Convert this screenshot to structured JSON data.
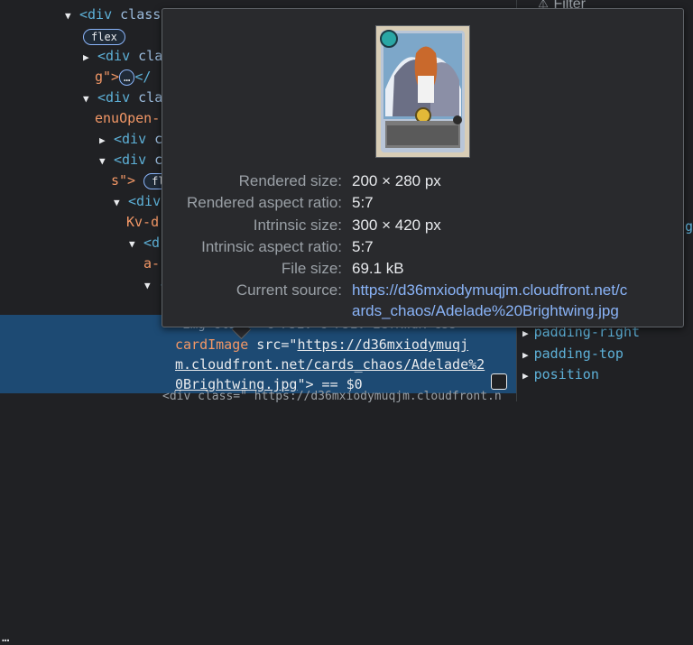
{
  "dom": {
    "line1": {
      "open": "<div",
      "attr": "class"
    },
    "badge_flex": "flex",
    "line3": {
      "open": "<div",
      "attr": "cla"
    },
    "line4": {
      "text1": "g\">",
      "ellipsis": "…",
      "text2": "</"
    },
    "line5": {
      "open": "<div",
      "attr": "cla"
    },
    "line6": {
      "text": "enuOpen-"
    },
    "line7": {
      "open": "<div",
      "attr": "c"
    },
    "line8": {
      "open": "<div",
      "attr": "c"
    },
    "line9": {
      "text": "s\">",
      "badge": "fl"
    },
    "line10": {
      "open": "<div"
    },
    "line11": {
      "text": "Kv-d"
    },
    "line12": {
      "open": "<d"
    },
    "line13": {
      "text": "a-"
    },
    "line14": {
      "text": "-"
    }
  },
  "selected": {
    "dots": "…",
    "img_partial": "<img class=\"c-PJEV c-PJEV-ieTKwdK-css",
    "line2_class": "cardImage",
    "src_attr": " src=\"",
    "url_part1": "https://d36mxiodymuqj",
    "url_part2": "m.cloudfront.net/cards_chaos/Adelade%2",
    "url_part3": "0Brightwing.jpg",
    "tail": "\"> == $0",
    "next_line": "<div class=\"     https://d36mxiodymuqjm.cloudfront.n"
  },
  "styles_panel": {
    "filter_label": "Filter",
    "props": [
      "padding-right",
      "padding-top",
      "position"
    ],
    "right_text": "g"
  },
  "tooltip": {
    "rows": [
      {
        "label": "Rendered size:",
        "value": "200 × 280 px"
      },
      {
        "label": "Rendered aspect ratio:",
        "value": "5:7"
      },
      {
        "label": "Intrinsic size:",
        "value": "300 × 420 px"
      },
      {
        "label": "Intrinsic aspect ratio:",
        "value": "5:7"
      },
      {
        "label": "File size:",
        "value": "69.1 kB"
      }
    ],
    "source_label": "Current source:",
    "source_line1": "https://d36mxiodymuqjm.cloudfront.net/c",
    "source_line2": "ards_chaos/Adelade%20Brightwing.jpg"
  },
  "colors": {
    "background": "#202124",
    "tag": "#5db0d7",
    "attr_value": "#f29766",
    "selection": "#1d4a73",
    "link": "#8ab4f8"
  }
}
